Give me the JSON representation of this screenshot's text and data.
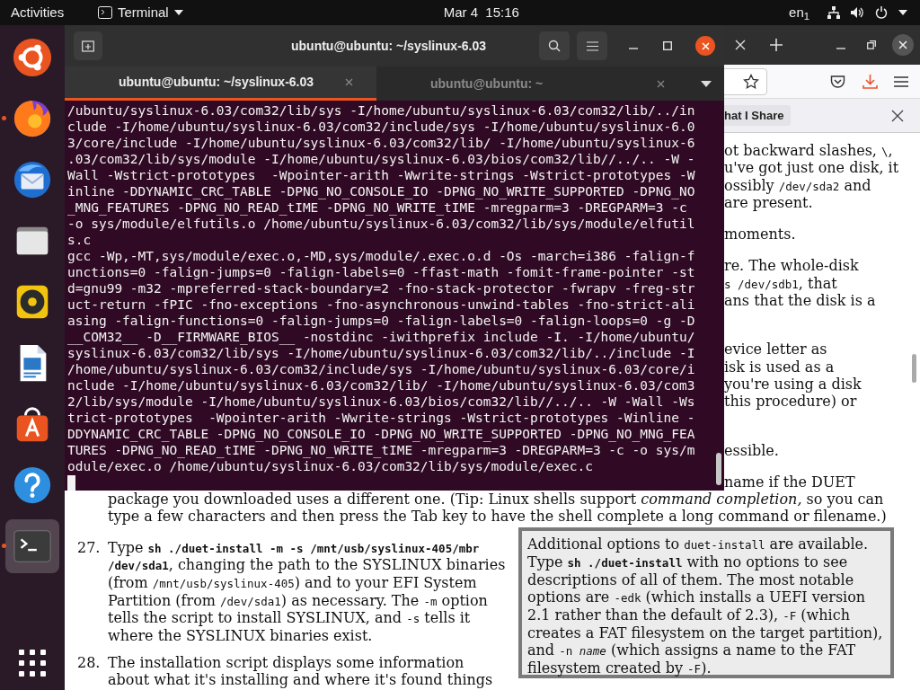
{
  "top_bar": {
    "activities": "Activities",
    "app_menu": "Terminal",
    "clock": "Mar 4  15:16",
    "input_source": "en$_{1}$"
  },
  "dock": [
    {
      "running": false,
      "selected": false
    },
    {
      "running": true,
      "selected": false
    },
    {
      "running": false,
      "selected": false
    },
    {
      "running": false,
      "selected": false
    },
    {
      "running": false,
      "selected": false
    },
    {
      "running": false,
      "selected": false
    },
    {
      "running": false,
      "selected": false
    },
    {
      "running": false,
      "selected": false
    },
    {
      "running": true,
      "selected": true
    },
    {
      "running": false,
      "selected": false
    }
  ],
  "terminal": {
    "title": "ubuntu@ubuntu: ~/syslinux-6.03",
    "tabs": [
      {
        "label": "ubuntu@ubuntu: ~/syslinux-6.03",
        "selected": true
      },
      {
        "label": "ubuntu@ubuntu: ~",
        "selected": false
      }
    ],
    "lines": [
      "/ubuntu/syslinux-6.03/com32/lib/sys -I/home/ubuntu/syslinux-6.03/com32/lib/../in",
      "clude -I/home/ubuntu/syslinux-6.03/com32/include/sys -I/home/ubuntu/syslinux-6.0",
      "3/core/include -I/home/ubuntu/syslinux-6.03/com32/lib/ -I/home/ubuntu/syslinux-6",
      ".03/com32/lib/sys/module -I/home/ubuntu/syslinux-6.03/bios/com32/lib//../.. -W -",
      "Wall -Wstrict-prototypes  -Wpointer-arith -Wwrite-strings -Wstrict-prototypes -W",
      "inline -DDYNAMIC_CRC_TABLE -DPNG_NO_CONSOLE_IO -DPNG_NO_WRITE_SUPPORTED -DPNG_NO",
      "_MNG_FEATURES -DPNG_NO_READ_tIME -DPNG_NO_WRITE_tIME -mregparm=3 -DREGPARM=3 -c",
      "-o sys/module/elfutils.o /home/ubuntu/syslinux-6.03/com32/lib/sys/module/elfutil",
      "s.c",
      "gcc -Wp,-MT,sys/module/exec.o,-MD,sys/module/.exec.o.d -Os -march=i386 -falign-f",
      "unctions=0 -falign-jumps=0 -falign-labels=0 -ffast-math -fomit-frame-pointer -st",
      "d=gnu99 -m32 -mpreferred-stack-boundary=2 -fno-stack-protector -fwrapv -freg-str",
      "uct-return -fPIC -fno-exceptions -fno-asynchronous-unwind-tables -fno-strict-ali",
      "asing -falign-functions=0 -falign-jumps=0 -falign-labels=0 -falign-loops=0 -g -D",
      "__COM32__ -D__FIRMWARE_BIOS__ -nostdinc -iwithprefix include -I. -I/home/ubuntu/",
      "syslinux-6.03/com32/lib/sys -I/home/ubuntu/syslinux-6.03/com32/lib/../include -I",
      "/home/ubuntu/syslinux-6.03/com32/include/sys -I/home/ubuntu/syslinux-6.03/core/i",
      "nclude -I/home/ubuntu/syslinux-6.03/com32/lib/ -I/home/ubuntu/syslinux-6.03/com3",
      "2/lib/sys/module -I/home/ubuntu/syslinux-6.03/bios/com32/lib//../.. -W -Wall -Ws",
      "trict-prototypes  -Wpointer-arith -Wwrite-strings -Wstrict-prototypes -Winline -",
      "DDYNAMIC_CRC_TABLE -DPNG_NO_CONSOLE_IO -DPNG_NO_WRITE_SUPPORTED -DPNG_NO_MNG_FEA",
      "TURES -DPNG_NO_READ_tIME -DPNG_NO_WRITE_tIME -mregparm=3 -DREGPARM=3 -c -o sys/m",
      "odule/exec.o /home/ubuntu/syslinux-6.03/com32/lib/sys/module/exec.c"
    ]
  },
  "browser": {
    "notice": "hat I Share",
    "right_paragraphs": [
      [
        [
          {
            "text": "ot backward slashes, ",
            "kind": "plain"
          },
          {
            "text": "\\",
            "kind": "code"
          },
          {
            "text": ",",
            "kind": "plain"
          }
        ],
        "u've got just one disk, it",
        [
          {
            "text": "ossibly ",
            "kind": "plain"
          },
          {
            "text": "/dev/sda2",
            "kind": "code"
          },
          {
            "text": " and",
            "kind": "plain"
          }
        ],
        "are present."
      ],
      [
        "moments."
      ],
      [
        "re. The whole-disk",
        [
          {
            "text": "s /dev/sdb1",
            "kind": "code"
          },
          {
            "text": ", that",
            "kind": "plain"
          }
        ],
        "ans that the disk is a"
      ],
      [
        "evice letter as",
        "isk is used as a",
        "you're using a disk",
        "this procedure) or"
      ],
      [
        "essible."
      ],
      [
        "name if the DUET"
      ]
    ],
    "wide_lines": [
      [
        {
          "text": "package you downloaded uses a different one. (Tip: Linux shells support ",
          "kind": "plain"
        },
        {
          "text": "command completion,",
          "kind": "italic"
        },
        {
          "text": " so you can",
          "kind": "plain"
        }
      ],
      "type a few characters and then press the Tab key to have the shell complete a long command or filename.)"
    ],
    "steps": [
      {
        "number": "27.",
        "text": [
          {
            "text": "Type ",
            "kind": "plain"
          },
          {
            "text": "sh ./duet-install -m -s /mnt/usb/syslinux-405/mbr /dev/sda1",
            "kind": "code_bold"
          },
          {
            "text": ", changing the path to the SYSLINUX binaries (from ",
            "kind": "plain"
          },
          {
            "text": "/mnt/usb/syslinux-405",
            "kind": "code"
          },
          {
            "text": ") and to your EFI System Partition (from ",
            "kind": "plain"
          },
          {
            "text": "/dev/sda1",
            "kind": "code"
          },
          {
            "text": ") as necessary. The ",
            "kind": "plain"
          },
          {
            "text": "-m",
            "kind": "code"
          },
          {
            "text": " option tells the script to install SYSLINUX, and ",
            "kind": "plain"
          },
          {
            "text": "-s",
            "kind": "code"
          },
          {
            "text": " tells it where the SYSLINUX binaries exist.",
            "kind": "plain"
          }
        ]
      },
      {
        "number": "28.",
        "text": [
          {
            "text": "The installation script displays some information about what it's installing and where it's found things",
            "kind": "plain"
          }
        ]
      }
    ],
    "note": [
      {
        "text": "Additional options to ",
        "kind": "plain"
      },
      {
        "text": "duet-install",
        "kind": "code"
      },
      {
        "text": " are available. Type ",
        "kind": "plain"
      },
      {
        "text": "sh ./duet-install",
        "kind": "code_bold"
      },
      {
        "text": " with no options to see descriptions of all of them. The most notable options are ",
        "kind": "plain"
      },
      {
        "text": "-edk",
        "kind": "code"
      },
      {
        "text": " (which installs a UEFI version 2.1 rather than the default of 2.3), ",
        "kind": "plain"
      },
      {
        "text": "-F",
        "kind": "code"
      },
      {
        "text": " (which creates a FAT filesystem on the target partition), and ",
        "kind": "plain"
      },
      {
        "text": "-n ",
        "kind": "code"
      },
      {
        "text": "name",
        "kind": "code_italic"
      },
      {
        "text": " (which assigns a name to the FAT filesystem created by ",
        "kind": "plain"
      },
      {
        "text": "-F",
        "kind": "code"
      },
      {
        "text": ").",
        "kind": "plain"
      }
    ]
  }
}
